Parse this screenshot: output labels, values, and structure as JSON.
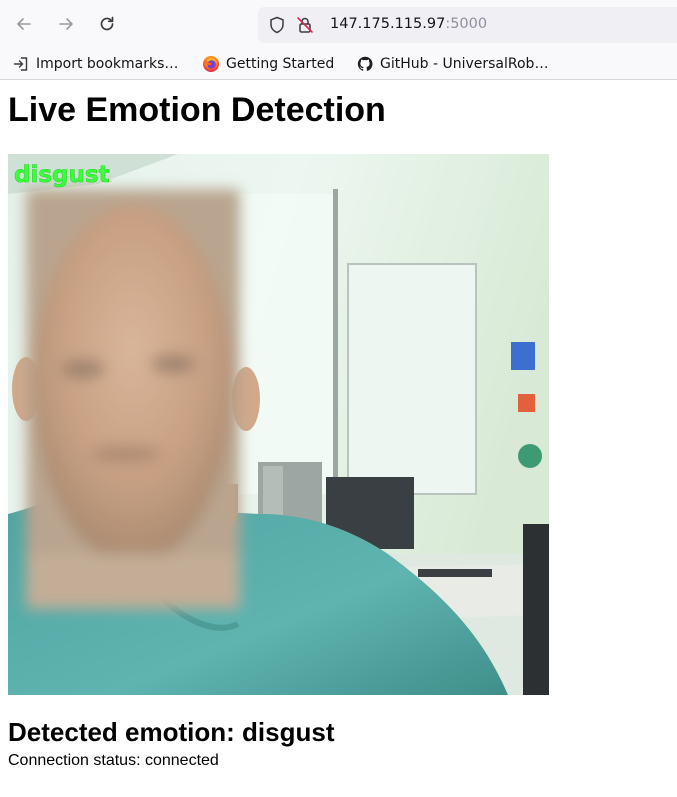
{
  "browser": {
    "url_host": "147.175.115.97",
    "url_port": ":5000",
    "bookmarks": [
      {
        "label": "Import bookmarks…",
        "icon": "import-icon"
      },
      {
        "label": "Getting Started",
        "icon": "firefox-icon"
      },
      {
        "label": "GitHub - UniversalRob…",
        "icon": "github-icon"
      }
    ]
  },
  "page": {
    "title": "Live Emotion Detection",
    "overlay_label": "disgust",
    "overlay_color": "#3cff3c",
    "detected_prefix": "Detected emotion: ",
    "detected_emotion": "disgust",
    "status_prefix": "Connection status: ",
    "status_value": "connected"
  }
}
